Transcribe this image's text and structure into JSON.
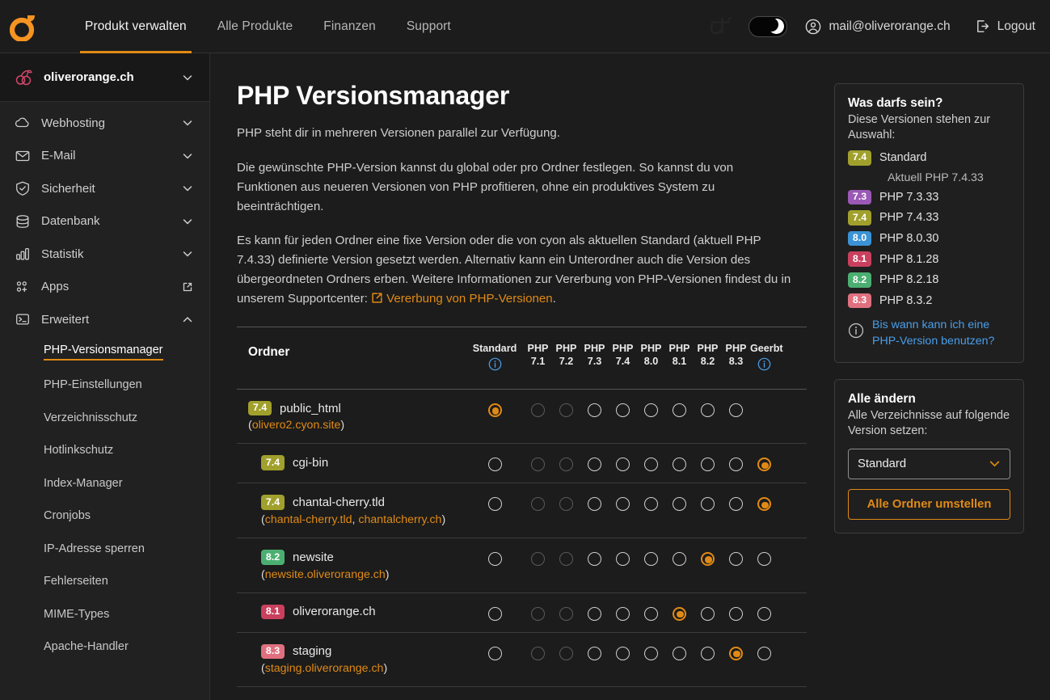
{
  "header": {
    "logo_name": "cyon-logo",
    "nav": [
      {
        "label": "Produkt verwalten",
        "active": true
      },
      {
        "label": "Alle Produkte",
        "active": false
      },
      {
        "label": "Finanzen",
        "active": false
      },
      {
        "label": "Support",
        "active": false
      }
    ],
    "darkmode_toggle_on": true,
    "user_email": "mail@oliverorange.ch",
    "logout_label": "Logout"
  },
  "sidebar": {
    "domain": "oliverorange.ch",
    "items": [
      {
        "label": "Webhosting",
        "icon": "cloud-icon",
        "chevron": "down"
      },
      {
        "label": "E-Mail",
        "icon": "envelope-icon",
        "chevron": "down"
      },
      {
        "label": "Sicherheit",
        "icon": "shield-check-icon",
        "chevron": "down"
      },
      {
        "label": "Datenbank",
        "icon": "database-icon",
        "chevron": "down"
      },
      {
        "label": "Statistik",
        "icon": "bar-chart-icon",
        "chevron": "down"
      },
      {
        "label": "Apps",
        "icon": "apps-icon",
        "chevron": "external"
      },
      {
        "label": "Erweitert",
        "icon": "terminal-icon",
        "chevron": "up"
      }
    ],
    "subitems": [
      {
        "label": "PHP-Versionsmanager",
        "active": true
      },
      {
        "label": "PHP-Einstellungen",
        "active": false
      },
      {
        "label": "Verzeichnisschutz",
        "active": false
      },
      {
        "label": "Hotlinkschutz",
        "active": false
      },
      {
        "label": "Index-Manager",
        "active": false
      },
      {
        "label": "Cronjobs",
        "active": false
      },
      {
        "label": "IP-Adresse sperren",
        "active": false
      },
      {
        "label": "Fehlerseiten",
        "active": false
      },
      {
        "label": "MIME-Types",
        "active": false
      },
      {
        "label": "Apache-Handler",
        "active": false
      }
    ]
  },
  "main": {
    "title": "PHP Versionsmanager",
    "paragraph1": "PHP steht dir in mehreren Versionen parallel zur Verfügung.",
    "paragraph2": "Die gewünschte PHP-Version kannst du global oder pro Ordner festlegen. So kannst du von Funktionen aus neueren Versionen von PHP profitieren, ohne ein produktives System zu beeinträchtigen.",
    "paragraph3_pre": "Es kann für jeden Ordner eine fixe Version oder die von cyon als aktuellen Standard (aktuell PHP 7.4.33) definierte Version gesetzt werden. Alternativ kann ein Unterordner auch die Version des übergeordneten Ordners erben. Weitere Informationen zur Vererbung von PHP-Versionen findest du in unserem Supportcenter: ",
    "paragraph3_link": "Vererbung von PHP-Versionen",
    "paragraph3_post": "."
  },
  "table": {
    "folder_header": "Ordner",
    "columns": [
      {
        "top": "Standard",
        "bottom": "",
        "info": true,
        "wide": true
      },
      {
        "top": "PHP",
        "bottom": "7.1",
        "info": false,
        "wide": false
      },
      {
        "top": "PHP",
        "bottom": "7.2",
        "info": false,
        "wide": false
      },
      {
        "top": "PHP",
        "bottom": "7.3",
        "info": false,
        "wide": false
      },
      {
        "top": "PHP",
        "bottom": "7.4",
        "info": false,
        "wide": false
      },
      {
        "top": "PHP",
        "bottom": "8.0",
        "info": false,
        "wide": false
      },
      {
        "top": "PHP",
        "bottom": "8.1",
        "info": false,
        "wide": false
      },
      {
        "top": "PHP",
        "bottom": "8.2",
        "info": false,
        "wide": false
      },
      {
        "top": "PHP",
        "bottom": "8.3",
        "info": false,
        "wide": false
      },
      {
        "top": "Geerbt",
        "bottom": "",
        "info": true,
        "wide": false
      }
    ],
    "rows": [
      {
        "badge": "7.4",
        "badge_color": "#a1a02d",
        "name": "public_html",
        "sub": false,
        "aliases": [
          "olivero2.cyon.site"
        ],
        "selected": 0,
        "has_inherit": false,
        "disabled": [
          1,
          2
        ]
      },
      {
        "badge": "7.4",
        "badge_color": "#a1a02d",
        "name": "cgi-bin",
        "sub": true,
        "aliases": [],
        "selected": 9,
        "has_inherit": true,
        "disabled": [
          1,
          2
        ]
      },
      {
        "badge": "7.4",
        "badge_color": "#a1a02d",
        "name": "chantal-cherry.tld",
        "sub": true,
        "aliases": [
          "chantal-cherry.tld",
          "chantalcherry.ch"
        ],
        "selected": 9,
        "has_inherit": true,
        "disabled": [
          1,
          2
        ]
      },
      {
        "badge": "8.2",
        "badge_color": "#4caf72",
        "name": "newsite",
        "sub": true,
        "aliases": [
          "newsite.oliverorange.ch"
        ],
        "selected": 7,
        "has_inherit": true,
        "disabled": [
          1,
          2
        ]
      },
      {
        "badge": "8.1",
        "badge_color": "#c9405e",
        "name": "oliverorange.ch",
        "sub": true,
        "aliases": [],
        "selected": 6,
        "has_inherit": true,
        "disabled": [
          1,
          2
        ]
      },
      {
        "badge": "8.3",
        "badge_color": "#e0707f",
        "name": "staging",
        "sub": true,
        "aliases": [
          "staging.oliverorange.ch"
        ],
        "selected": 8,
        "has_inherit": true,
        "disabled": [
          1,
          2
        ]
      }
    ]
  },
  "versions_card": {
    "title": "Was darfs sein?",
    "subtitle": "Diese Versionen stehen zur Auswahl:",
    "items": [
      {
        "badge": "7.4",
        "color": "#a1a02d",
        "label": "Standard"
      },
      {
        "badge": "7.3",
        "color": "#9b59b6",
        "label": "PHP 7.3.33"
      },
      {
        "badge": "7.4",
        "color": "#a1a02d",
        "label": "PHP 7.4.33"
      },
      {
        "badge": "8.0",
        "color": "#3b93d6",
        "label": "PHP 8.0.30"
      },
      {
        "badge": "8.1",
        "color": "#c9405e",
        "label": "PHP 8.1.28"
      },
      {
        "badge": "8.2",
        "color": "#4caf72",
        "label": "PHP 8.2.18"
      },
      {
        "badge": "8.3",
        "color": "#e0707f",
        "label": "PHP 8.3.2"
      }
    ],
    "note": "Aktuell PHP 7.4.33",
    "info_link": "Bis wann kann ich eine PHP-Version benutzen?"
  },
  "change_all_card": {
    "title": "Alle ändern",
    "subtitle": "Alle Verzeichnisse auf folgende Version setzen:",
    "select_value": "Standard",
    "button_label": "Alle Ordner umstellen"
  },
  "colors": {
    "accent": "#e08a15",
    "info_blue": "#4a9eea",
    "bg": "#1c1c1c",
    "sidebar_bg": "#212121"
  }
}
